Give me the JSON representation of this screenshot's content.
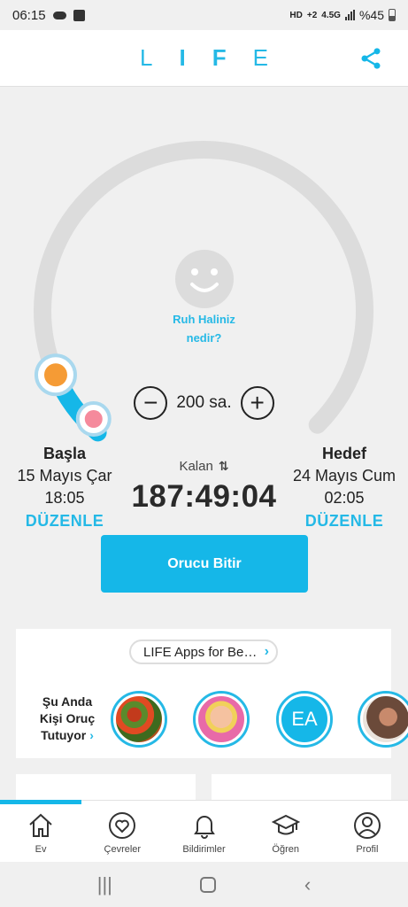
{
  "status": {
    "time": "06:15",
    "net": "HD",
    "sub": "+2",
    "net2": "4.5G",
    "battery": "%45"
  },
  "header": {
    "logo_letters": [
      "L",
      "I",
      "F",
      "E"
    ]
  },
  "mood": {
    "line1": "Ruh Haliniz",
    "line2": "nedir?"
  },
  "fast": {
    "hours": "200 sa.",
    "progress": 0.08,
    "start": {
      "title": "Başla",
      "date": "15 Mayıs Çar",
      "time": "18:05",
      "edit": "DÜZENLE"
    },
    "goal": {
      "title": "Hedef",
      "date": "24 Mayıs Cum",
      "time": "02:05",
      "edit": "DÜZENLE"
    },
    "remaining_label": "Kalan",
    "remaining_value": "187:49:04",
    "end_button": "Orucu Bitir"
  },
  "community": {
    "apps_pill": "LIFE Apps for Be…",
    "fasting_now_1": "Şu Anda",
    "fasting_now_2": "Kişi Oruç",
    "fasting_now_3": "Tutuyor",
    "avatar_initials": "EA"
  },
  "tabs": [
    {
      "label": "Ev",
      "icon": "home-icon"
    },
    {
      "label": "Çevreler",
      "icon": "heart-circle-icon"
    },
    {
      "label": "Bildirimler",
      "icon": "bell-icon"
    },
    {
      "label": "Öğren",
      "icon": "graduation-cap-icon"
    },
    {
      "label": "Profil",
      "icon": "profile-icon"
    }
  ],
  "colors": {
    "accent": "#15b7e8",
    "ring_track": "#dcdcdc"
  }
}
